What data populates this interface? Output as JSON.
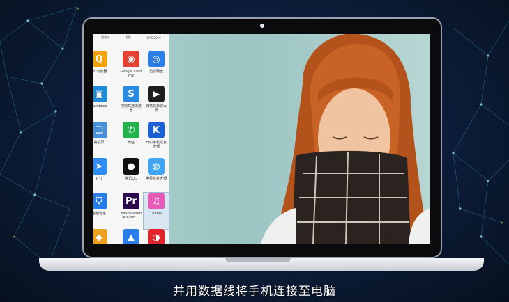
{
  "caption": "并用数据线将手机连接至电脑",
  "desktop": {
    "top_labels": [
      "回收站",
      "视频",
      "WPS 2019"
    ],
    "icons": [
      {
        "label": "QQ浏览器",
        "glyph": "Q",
        "color": "#f2a20c",
        "icon": "person-icon"
      },
      {
        "label": "Google Chro\nme",
        "glyph": "◉",
        "color": "#e44133",
        "icon": "chrome-icon"
      },
      {
        "label": "迅雷网盘",
        "glyph": "◎",
        "color": "#2b7de9",
        "icon": "cloud-icon"
      },
      {
        "label": "Camtasia",
        "glyph": "▣",
        "color": "#1f8bd6",
        "icon": "monitor-icon"
      },
      {
        "label": "搜狗高速浏览\n器",
        "glyph": "S",
        "color": "#2a8ae2",
        "icon": "sogou-icon"
      },
      {
        "label": "嗨格式录屏大\n师",
        "glyph": "▶",
        "color": "#1e1e1e",
        "icon": "screen-recorder-icon"
      },
      {
        "label": "易投屏",
        "glyph": "❏",
        "color": "#4a90d9",
        "icon": "cast-icon"
      },
      {
        "label": "微信",
        "glyph": "✆",
        "color": "#22b14c",
        "icon": "wechat-icon"
      },
      {
        "label": "开心手机恢复\n大师",
        "glyph": "K",
        "color": "#1b5ed6",
        "icon": "k-icon"
      },
      {
        "label": "钉钉",
        "glyph": "➤",
        "color": "#2f8cf0",
        "icon": "dingtalk-icon"
      },
      {
        "label": "腾讯QQ",
        "glyph": "●",
        "color": "#111111",
        "icon": "qq-icon"
      },
      {
        "label": "苹果恢复大师",
        "glyph": "◍",
        "color": "#3fa4f4",
        "icon": "apple-recovery-icon"
      },
      {
        "label": "电脑管家",
        "glyph": "⛉",
        "color": "#2a7ce6",
        "icon": "shield-icon"
      },
      {
        "label": "Adobe Prem\niere Pro ...",
        "glyph": "Pr",
        "color": "#2a0a4a",
        "icon": "premiere-icon"
      },
      {
        "label": "iTunes",
        "glyph": "♫",
        "color": "#e65ab8",
        "icon": "itunes-icon"
      },
      {
        "label": "",
        "glyph": "◆",
        "color": "#f0a020",
        "icon": "colorful-icon"
      },
      {
        "label": "",
        "glyph": "▲",
        "color": "#2a7ce6",
        "icon": "triangle-app-icon"
      },
      {
        "label": "",
        "glyph": "◑",
        "color": "#e0262a",
        "icon": "netease-music-icon"
      }
    ]
  }
}
